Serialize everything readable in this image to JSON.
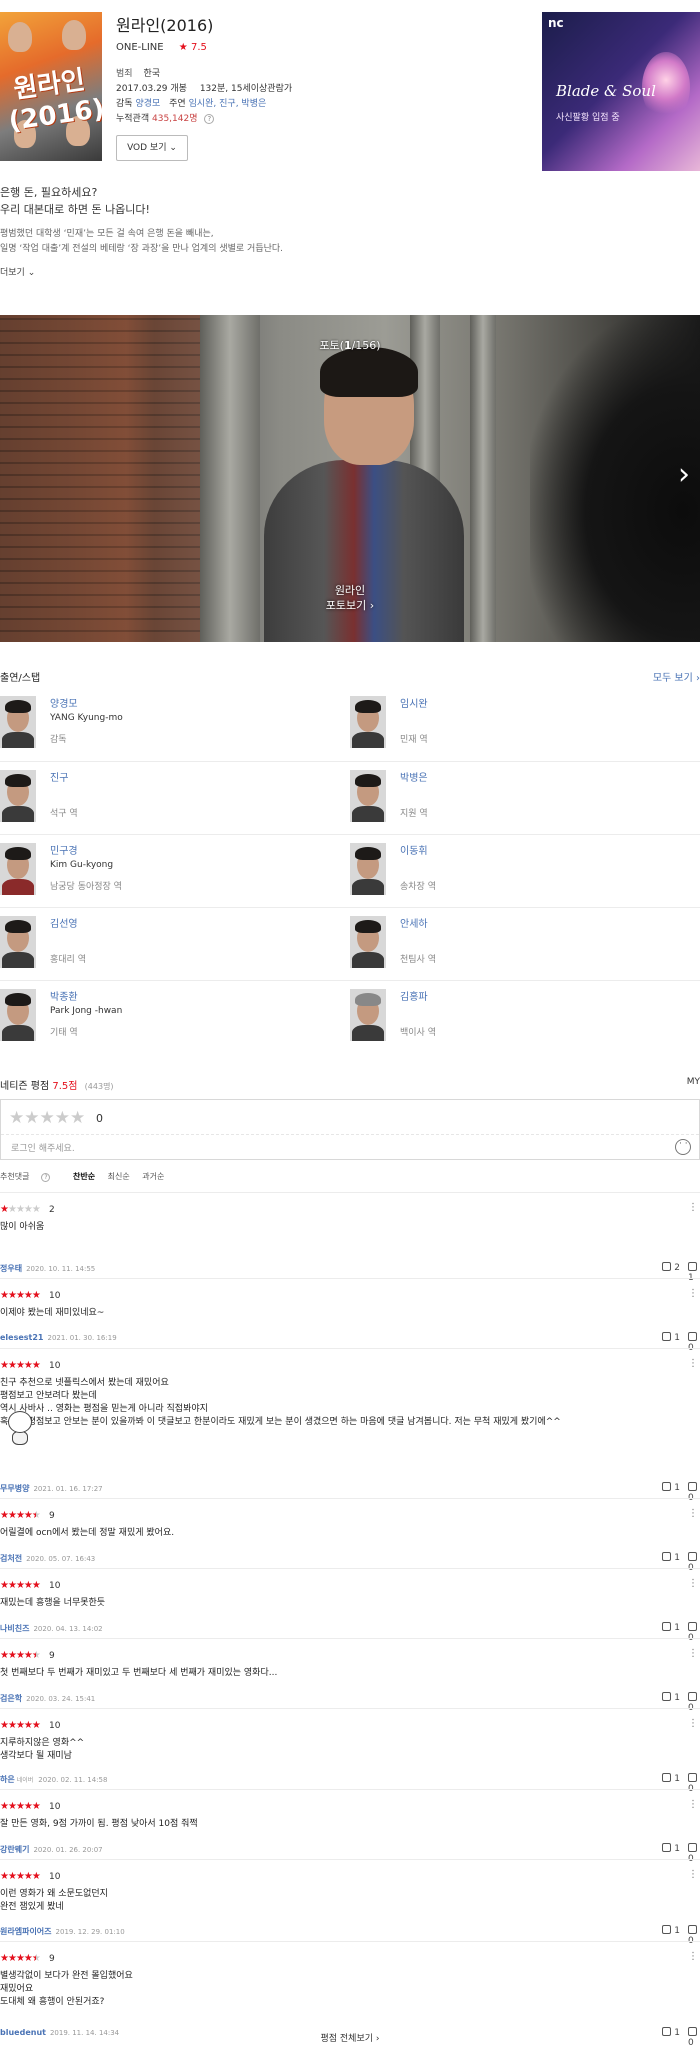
{
  "movie": {
    "title": "원라인(2016)",
    "one_line_label": "ONE-LINE",
    "star_glyph": "★",
    "rating": "7.5",
    "genre_label": "범죄",
    "country": "한국",
    "release": "2017.03.29 개봉",
    "runtime_age": "132분, 15세이상관람가",
    "director_label": "감독",
    "director": "양경모",
    "cast_label": "주연",
    "main_cast": "임시완, 진구, 박병은",
    "audience_label": "누적관객",
    "audience_value": "435,142명",
    "help_glyph": "?",
    "vod_button": "VOD 보기",
    "vod_chevron": "⌄"
  },
  "ad": {
    "brand": "nc",
    "title": "Blade & Soul",
    "subtitle": "사신팔황 입점 중"
  },
  "synopsis": {
    "tag_line_1": "은행 돈, 필요하세요?",
    "tag_line_2": "우리 대본대로 하면 돈 나옵니다!",
    "body_1": "평범했던 대학생 ‘민재’는 모든 걸 속여 은행 돈을 빼내는,",
    "body_2": "일명 ‘작업 대출’계 전설의 베테랑 ‘장 과장’을 만나 업계의 샛별로 거듭난다.",
    "more": "더보기 ⌄"
  },
  "gallery": {
    "counter_prefix": "포토(",
    "counter_current": "1",
    "counter_suffix": "/156)",
    "next_glyph": "›",
    "caption_title": "원라인",
    "caption_action": "포토보기 ›"
  },
  "cast_section": {
    "title": "출연/스탭",
    "view_all": "모두 보기 ›",
    "people": [
      {
        "name": "양경모",
        "eng": "YANG Kyung-mo",
        "role": "감독"
      },
      {
        "name": "임시완",
        "eng": "",
        "role": "민재 역"
      },
      {
        "name": "진구",
        "eng": "",
        "role": "석구 역"
      },
      {
        "name": "박병은",
        "eng": "",
        "role": "지원 역"
      },
      {
        "name": "민구경",
        "eng": "Kim Gu-kyong",
        "role": "남궁당 동아정장 역"
      },
      {
        "name": "이동휘",
        "eng": "",
        "role": "송차장 역"
      },
      {
        "name": "김선영",
        "eng": "",
        "role": "홍대리 역"
      },
      {
        "name": "안세하",
        "eng": "",
        "role": "천팀사 역"
      },
      {
        "name": "박종환",
        "eng": "Park Jong -hwan",
        "role": "기태 역"
      },
      {
        "name": "김홍파",
        "eng": "",
        "role": "백이사 역"
      }
    ]
  },
  "ratings": {
    "title": "네티즌 평점",
    "score": "7.5점",
    "count": "(443명)",
    "my_label": "MY",
    "empty_stars": "★★★★★",
    "my_score": "0",
    "login_placeholder": "로그인 해주세요.",
    "sort_recommended": "추천댓글",
    "sort_help": "?",
    "sort_sympathy": "찬반순",
    "sort_latest": "최신순",
    "sort_oldest": "과거순",
    "view_all": "평점 전체보기 ›",
    "accent_color": "#e4101d"
  },
  "reviews": [
    {
      "stars": 1,
      "score": "2",
      "text": "많이 아쉬움",
      "nick": "정우태",
      "badge": "",
      "date": "2020. 10. 11. 14:55",
      "likes": "2",
      "dislikes": "1"
    },
    {
      "stars": 5,
      "score": "10",
      "text": "이제야 봤는데 재미있네요~",
      "nick": "elesest21",
      "badge": "",
      "date": "2021. 01. 30. 16:19",
      "likes": "1",
      "dislikes": "0"
    },
    {
      "stars": 5,
      "score": "10",
      "text": "친구 추천으로 넷플릭스에서 봤는데 재밌어요\n평점보고 안보려다 봤는데\n역시 사바사 .. 영화는 평점을 믿는게 아니라 직접봐야지\n혹시나 평점보고 안보는 분이 있을까봐 이 댓글보고 한분이라도 재밌게 보는 분이 생겼으면 하는 마음에 댓글 남겨봅니다. 저는 무척 재밌게 봤기에^^",
      "nick": "무무병양",
      "badge": "",
      "date": "2021. 01. 16. 17:27",
      "likes": "1",
      "dislikes": "0"
    },
    {
      "stars": 4.5,
      "score": "9",
      "text": "어릴결에 ocn에서 봤는데 정말 재밌게 봤어요.",
      "nick": "검처전",
      "badge": "",
      "date": "2020. 05. 07. 16:43",
      "likes": "1",
      "dislikes": "0"
    },
    {
      "stars": 5,
      "score": "10",
      "text": "재밌는데 흥행을 너무못한듯",
      "nick": "나비친즈",
      "badge": "",
      "date": "2020. 04. 13. 14:02",
      "likes": "1",
      "dislikes": "0"
    },
    {
      "stars": 4.5,
      "score": "9",
      "text": "첫 번째보다 두 번째가 재미있고 두 번째보다 세 번째가 재미있는 영화다...",
      "nick": "검은학",
      "badge": "",
      "date": "2020. 03. 24. 15:41",
      "likes": "1",
      "dislikes": "0"
    },
    {
      "stars": 5,
      "score": "10",
      "text": "지루하지않은 영화^^\n생각보다 될 재미남",
      "nick": "하은",
      "badge": "네이버",
      "date": "2020. 02. 11. 14:58",
      "likes": "1",
      "dislikes": "0"
    },
    {
      "stars": 5,
      "score": "10",
      "text": "잘 만든 영화, 9점 가까이 됨. 평점 낮아서 10점 줘쩍",
      "nick": "강란뭬기",
      "badge": "",
      "date": "2020. 01. 26. 20:07",
      "likes": "1",
      "dislikes": "0"
    },
    {
      "stars": 5,
      "score": "10",
      "text": "이런 영화가 왜 소문도없던지\n완전 잼있게 봤네",
      "nick": "원라엠파이어즈",
      "badge": "",
      "date": "2019. 12. 29. 01:10",
      "likes": "1",
      "dislikes": "0"
    },
    {
      "stars": 4.5,
      "score": "9",
      "text": "별생각없이 보다가 완전 몰입했어요\n재밌어요\n도대체 왜 흥행이 안된거죠?",
      "nick": "bluedenut",
      "badge": "",
      "date": "2019. 11. 14. 14:34",
      "likes": "1",
      "dislikes": "0"
    }
  ]
}
